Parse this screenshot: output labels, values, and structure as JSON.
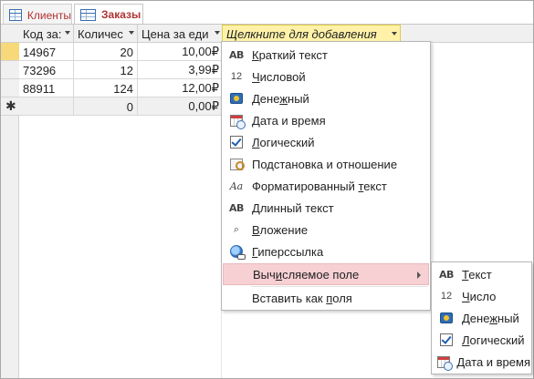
{
  "tabs": [
    {
      "label": "Клиенты",
      "active": false
    },
    {
      "label": "Заказы",
      "active": true
    }
  ],
  "datasheet": {
    "columns": [
      {
        "label": "Код за:",
        "dropdown": true
      },
      {
        "label": "Количес",
        "dropdown": true
      },
      {
        "label": "Цена за еди",
        "dropdown": true
      },
      {
        "label": "Щелкните для добавления",
        "dropdown": true
      }
    ],
    "rows": [
      {
        "code": "14967",
        "qty": "20",
        "price": "10,00₽"
      },
      {
        "code": "73296",
        "qty": "12",
        "price": "3,99₽"
      },
      {
        "code": "88911",
        "qty": "124",
        "price": "12,00₽"
      }
    ],
    "new_row": {
      "marker": "✱",
      "code": "",
      "qty": "0",
      "price": "0,00₽"
    }
  },
  "type_menu": {
    "items": [
      {
        "icon": "ab-icon",
        "before": "",
        "key": "К",
        "after": "раткий текст"
      },
      {
        "icon": "number-12-icon",
        "before": "",
        "key": "Ч",
        "after": "исловой"
      },
      {
        "icon": "currency-icon",
        "before": "Дене",
        "key": "ж",
        "after": "ный"
      },
      {
        "icon": "calendar-icon",
        "before": "",
        "key": "Д",
        "after": "ата и время"
      },
      {
        "icon": "checkbox-icon",
        "before": "",
        "key": "Л",
        "after": "огический"
      },
      {
        "icon": "lookup-icon",
        "before": "Подстановка и отношение",
        "key": "",
        "after": ""
      },
      {
        "icon": "formatted-text-icon",
        "before": "Форматированный ",
        "key": "т",
        "after": "екст"
      },
      {
        "icon": "ab-icon",
        "before": "",
        "key": "Д",
        "after": "линный текст"
      },
      {
        "icon": "attachment-icon",
        "before": "",
        "key": "В",
        "after": "ложение"
      },
      {
        "icon": "hyperlink-icon",
        "before": "",
        "key": "Г",
        "after": "иперссылка"
      }
    ],
    "calculated": {
      "before": "Выч",
      "key": "и",
      "after": "сляемое поле",
      "highlighted": true
    },
    "paste_as": {
      "before": "Вставить как ",
      "key": "п",
      "after": "оля"
    }
  },
  "calculated_submenu": {
    "items": [
      {
        "icon": "ab-icon",
        "before": "",
        "key": "Т",
        "after": "екст"
      },
      {
        "icon": "number-12-icon",
        "before": "",
        "key": "Ч",
        "after": "исло"
      },
      {
        "icon": "currency-icon",
        "before": "Дене",
        "key": "ж",
        "after": "ный"
      },
      {
        "icon": "checkbox-icon",
        "before": "",
        "key": "Л",
        "after": "огический"
      },
      {
        "icon": "calendar-icon",
        "before": "",
        "key": "Д",
        "after": "ата и время"
      }
    ]
  },
  "colors": {
    "tab_text": "#b03232",
    "current_row_selector": "#f7d97a",
    "add_column_header": "#fff2a8",
    "menu_highlight": "#f7d0d4",
    "icon_blue": "#2f6db5"
  }
}
